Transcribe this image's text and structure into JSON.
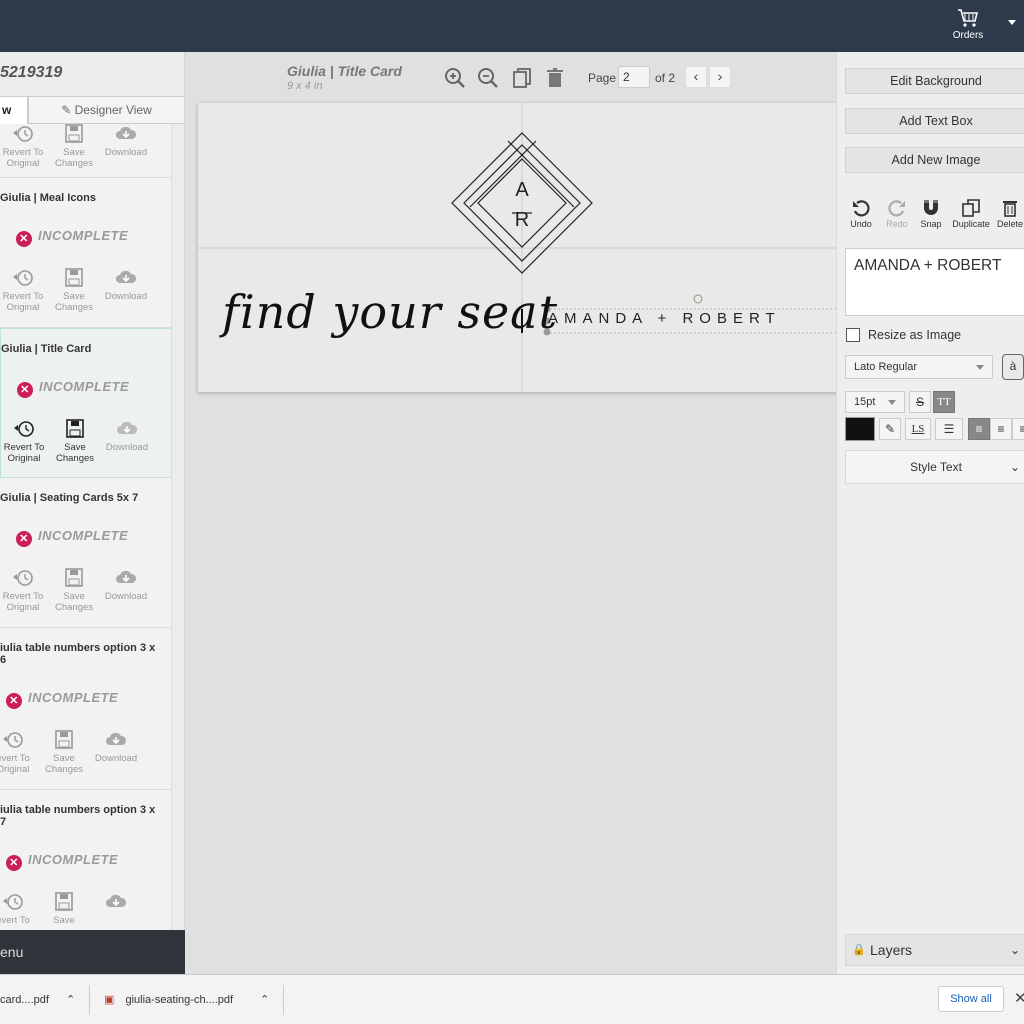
{
  "topbar": {
    "orders_label": "Orders"
  },
  "left_panel": {
    "order_id": "5219319",
    "tab_partial": "w",
    "tab_designer": "Designer View",
    "menu_label": "enu",
    "cards": [
      {
        "title": "",
        "status": "",
        "actions": [
          "Revert To Original",
          "Save Changes",
          "Download"
        ]
      },
      {
        "title": "Giulia | Meal Icons",
        "status": "INCOMPLETE",
        "actions": [
          "Revert To Original",
          "Save Changes",
          "Download"
        ]
      },
      {
        "title": "Giulia | Title Card",
        "status": "INCOMPLETE",
        "actions": [
          "Revert To Original",
          "Save Changes",
          "Download"
        ]
      },
      {
        "title": "Giulia | Seating Cards 5x 7",
        "status": "INCOMPLETE",
        "actions": [
          "Revert To Original",
          "Save Changes",
          "Download"
        ]
      },
      {
        "title": "iulia table numbers option 3 x 6",
        "status": "INCOMPLETE",
        "actions": [
          "evert To Original",
          "Save Changes",
          "Download"
        ]
      },
      {
        "title": "iulia table numbers option 3 x 7",
        "status": "INCOMPLETE",
        "actions": [
          "evert To",
          "Save",
          ""
        ]
      }
    ]
  },
  "canvas": {
    "doc_title": "Giulia | Title Card",
    "doc_size": "9 x 4 in",
    "page_label": "Page",
    "page_value": "2",
    "page_of": "of 2",
    "card": {
      "script_text": "find your seat",
      "names_text": "AMANDA + ROBERT",
      "monogram_top": "A",
      "monogram_bottom": "R"
    }
  },
  "right_panel": {
    "edit_background": "Edit Background",
    "add_text_box": "Add Text Box",
    "add_new_image": "Add New Image",
    "tools": [
      "Undo",
      "Redo",
      "Snap",
      "Duplicate",
      "Delete"
    ],
    "text_value": "AMANDA + ROBERT",
    "resize_label": "Resize as Image",
    "font": "Lato Regular",
    "font_size": "15pt",
    "style_text": "Style Text",
    "layers": "Layers",
    "text_color": "#111111"
  },
  "downloads": {
    "items": [
      "card....pdf",
      "giulia-seating-ch....pdf"
    ],
    "show_all": "Show all"
  },
  "colors": {
    "topbar": "#2c3a4b",
    "incomplete_badge": "#cc1f5a"
  }
}
